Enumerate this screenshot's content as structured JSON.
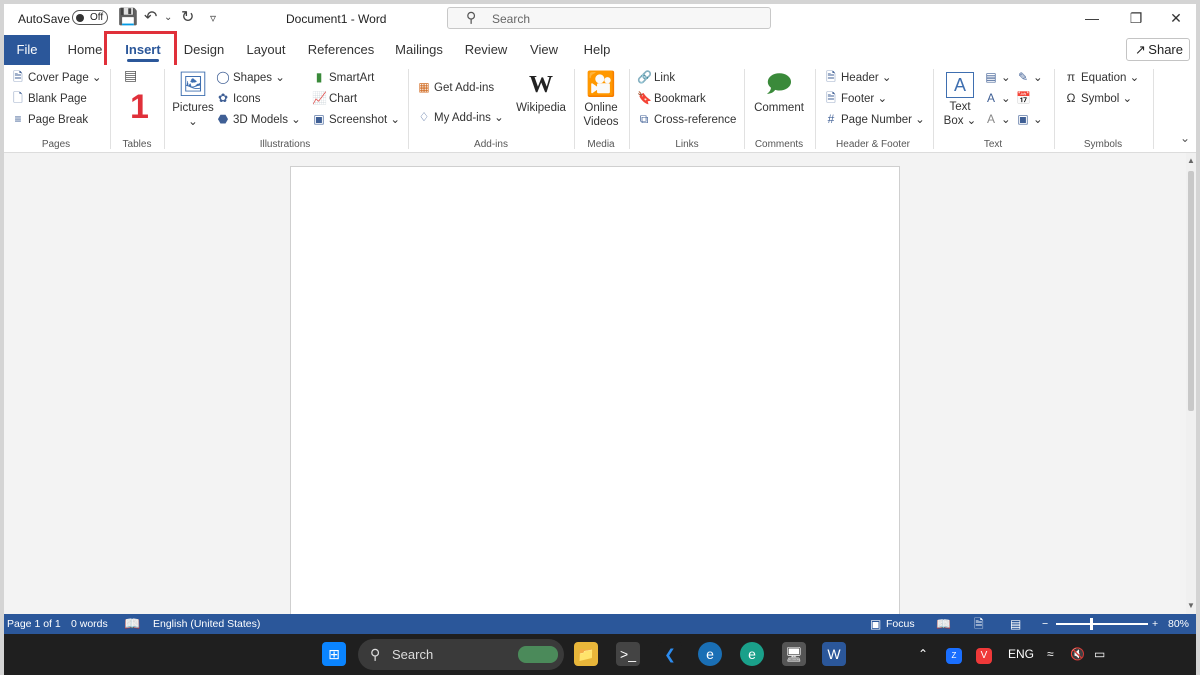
{
  "titlebar": {
    "autosave_label": "AutoSave",
    "autosave_state": "Off",
    "document_title": "Document1  -  Word",
    "search_placeholder": "Search"
  },
  "tabs": {
    "file": "File",
    "home": "Home",
    "insert": "Insert",
    "design": "Design",
    "layout": "Layout",
    "references": "References",
    "mailings": "Mailings",
    "review": "Review",
    "view": "View",
    "help": "Help",
    "share": "Share"
  },
  "annotation": {
    "step_number": "1",
    "color": "#e0303a"
  },
  "ribbon": {
    "pages": {
      "cover_page": "Cover Page",
      "blank_page": "Blank Page",
      "page_break": "Page Break",
      "label": "Pages"
    },
    "tables": {
      "label": "Tables"
    },
    "illustrations": {
      "pictures": "Pictures",
      "shapes": "Shapes",
      "icons": "Icons",
      "models_3d": "3D Models",
      "smartart": "SmartArt",
      "chart": "Chart",
      "screenshot": "Screenshot",
      "label": "Illustrations"
    },
    "addins": {
      "get_addins": "Get Add-ins",
      "my_addins": "My Add-ins",
      "wikipedia": "Wikipedia",
      "label": "Add-ins"
    },
    "media": {
      "online_videos_1": "Online",
      "online_videos_2": "Videos",
      "label": "Media"
    },
    "links": {
      "link": "Link",
      "bookmark": "Bookmark",
      "cross_reference": "Cross-reference",
      "label": "Links"
    },
    "comments": {
      "comment": "Comment",
      "label": "Comments"
    },
    "header_footer": {
      "header": "Header",
      "footer": "Footer",
      "page_number": "Page Number",
      "label": "Header & Footer"
    },
    "text": {
      "text_box_1": "Text",
      "text_box_2": "Box",
      "label": "Text"
    },
    "symbols": {
      "equation": "Equation",
      "symbol": "Symbol",
      "label": "Symbols"
    }
  },
  "statusbar": {
    "page": "Page 1 of 1",
    "words": "0 words",
    "language": "English (United States)",
    "focus": "Focus",
    "zoom": "80%",
    "zoom_minus": "−",
    "zoom_plus": "+"
  },
  "taskbar": {
    "search": "Search",
    "language": "ENG"
  },
  "colors": {
    "brand": "#2b579a",
    "highlight": "#e0303a"
  }
}
